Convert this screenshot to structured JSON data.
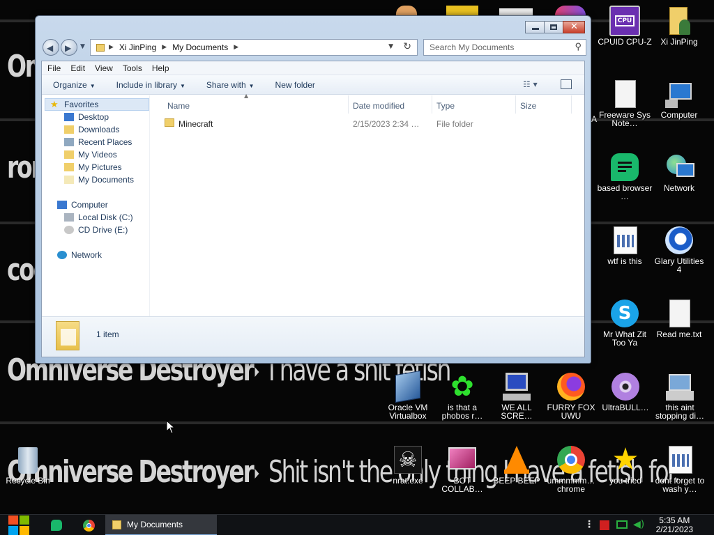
{
  "wallpaper": {
    "line1": "Om",
    "line2": "ror",
    "line3": "coc",
    "line4_name": "Omniverse Destroyer",
    "line4_msg": "I have a shit fetish",
    "line5_name": "Omniverse Destroyer",
    "line5_msg": "Shit isn't the only thing I have a fetish for."
  },
  "desktop_icons": [
    {
      "label": "CPUID CPU-Z",
      "icon": "cpuz-icon"
    },
    {
      "label": "Xi JinPing",
      "icon": "user-folder-icon"
    },
    {
      "label": "Freeware Sys Note…",
      "icon": "document-icon"
    },
    {
      "label": "Computer",
      "icon": "computer-icon"
    },
    {
      "label": "based browser …",
      "icon": "chat-app-icon"
    },
    {
      "label": "Network",
      "icon": "network-icon"
    },
    {
      "label": "wtf is this",
      "icon": "file-grid-icon"
    },
    {
      "label": "Glary Utilities 4",
      "icon": "glary-icon"
    },
    {
      "label": "Mr What Zit Too Ya",
      "icon": "skype-icon"
    },
    {
      "label": "Read me.txt",
      "icon": "text-file-icon"
    },
    {
      "label": "Oracle VM Virtualbox",
      "icon": "virtualbox-icon"
    },
    {
      "label": "is that a phobos r…",
      "icon": "green-flower-icon"
    },
    {
      "label": "WE ALL SCRE…",
      "icon": "computer-error-icon"
    },
    {
      "label": "FURRY FOX UWU",
      "icon": "firefox-icon"
    },
    {
      "label": "UltraBULL…",
      "icon": "disc-icon"
    },
    {
      "label": "this aint stopping di…",
      "icon": "installer-icon"
    },
    {
      "label": "Recycle Bin",
      "icon": "recycle-bin-icon"
    },
    {
      "label": "nrat.exe",
      "icon": "skull-icon"
    },
    {
      "label": "BOT COLLAB…",
      "icon": "film-icon"
    },
    {
      "label": "BEEP BEEP",
      "icon": "vlc-icon"
    },
    {
      "label": "ummmmm… chrome",
      "icon": "chrome-icon"
    },
    {
      "label": "you tried",
      "icon": "star-icon"
    },
    {
      "label": "dont forget to wash y…",
      "icon": "file-grid-icon"
    }
  ],
  "stray_label": "A",
  "explorer": {
    "breadcrumbs": [
      "Xi JinPing",
      "My Documents"
    ],
    "search_placeholder": "Search My Documents",
    "menu": [
      "File",
      "Edit",
      "View",
      "Tools",
      "Help"
    ],
    "commands": [
      "Organize",
      "Include in library",
      "Share with",
      "New folder"
    ],
    "nav": {
      "favorites": "Favorites",
      "favorites_items": [
        "Desktop",
        "Downloads",
        "Recent Places",
        "My Videos",
        "My Pictures",
        "My Documents"
      ],
      "computer": "Computer",
      "computer_items": [
        "Local Disk (C:)",
        "CD Drive (E:)"
      ],
      "network": "Network"
    },
    "columns": [
      "Name",
      "Date modified",
      "Type",
      "Size"
    ],
    "files": [
      {
        "name": "Minecraft",
        "date": "2/15/2023 2:34 …",
        "type": "File folder",
        "size": ""
      }
    ],
    "status": "1 item"
  },
  "taskbar": {
    "active_window": "My Documents",
    "time": "5:35 AM",
    "date": "2/21/2023"
  },
  "colors": {
    "accent": "#1e395b",
    "window_frame": "#b9cde5",
    "close_button": "#c8402b"
  }
}
